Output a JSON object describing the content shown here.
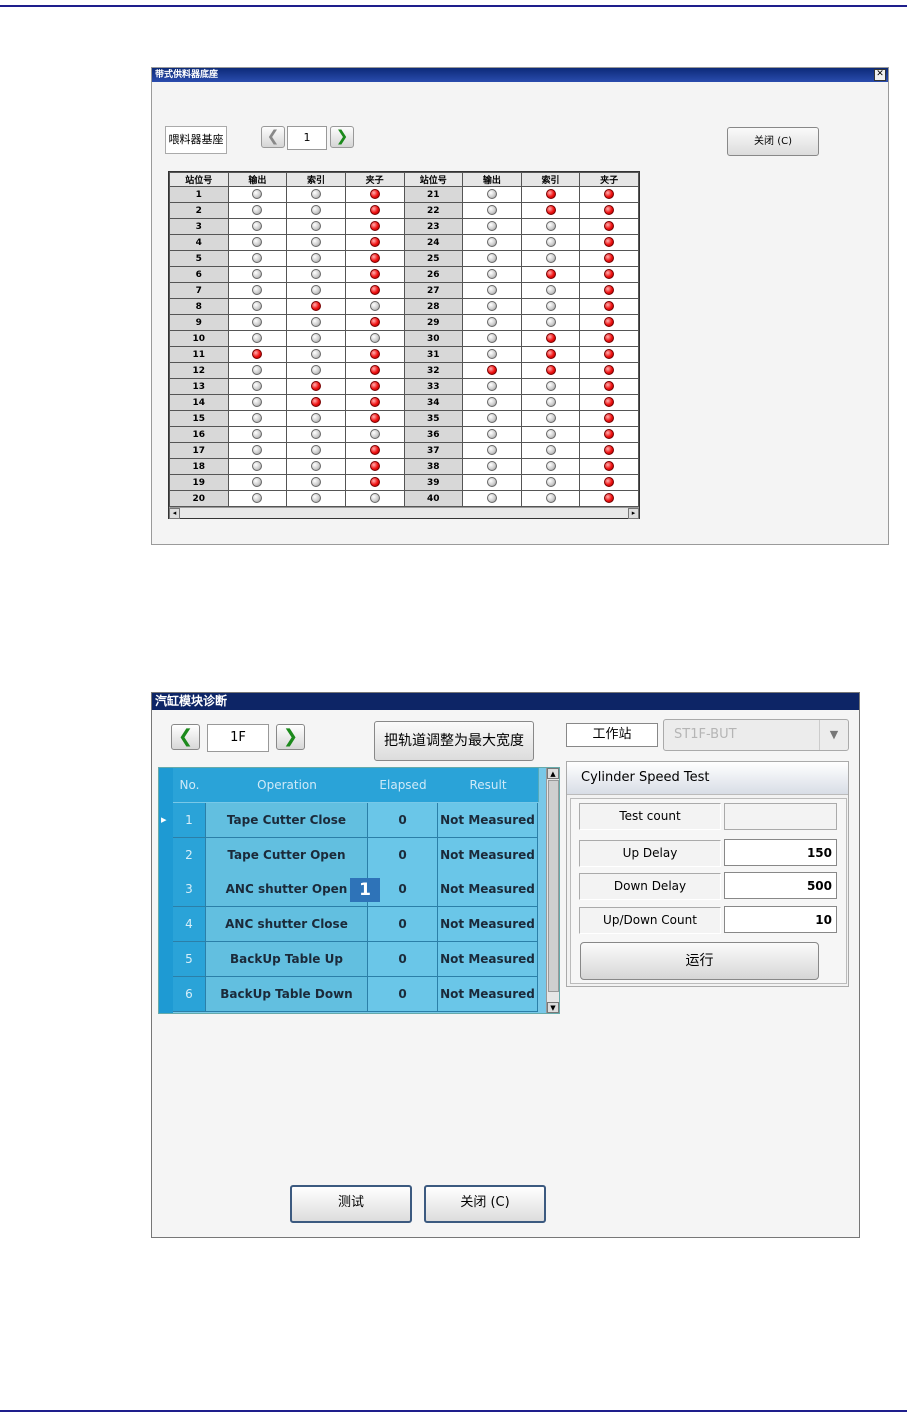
{
  "window1": {
    "title": "带式供料器底座",
    "close_x": "✕",
    "label": "喂料器基座",
    "page": "1",
    "close_button": "关闭 (C)",
    "prev": "❮",
    "next": "❯",
    "headers": [
      "站位号",
      "输出",
      "索引",
      "夹子",
      "站位号",
      "输出",
      "索引",
      "夹子"
    ],
    "rows": [
      {
        "a": "1",
        "a_out": 0,
        "a_idx": 0,
        "a_clamp": 1,
        "b": "21",
        "b_out": 0,
        "b_idx": 1,
        "b_clamp": 1
      },
      {
        "a": "2",
        "a_out": 0,
        "a_idx": 0,
        "a_clamp": 1,
        "b": "22",
        "b_out": 0,
        "b_idx": 1,
        "b_clamp": 1
      },
      {
        "a": "3",
        "a_out": 0,
        "a_idx": 0,
        "a_clamp": 1,
        "b": "23",
        "b_out": 0,
        "b_idx": 0,
        "b_clamp": 1
      },
      {
        "a": "4",
        "a_out": 0,
        "a_idx": 0,
        "a_clamp": 1,
        "b": "24",
        "b_out": 0,
        "b_idx": 0,
        "b_clamp": 1
      },
      {
        "a": "5",
        "a_out": 0,
        "a_idx": 0,
        "a_clamp": 1,
        "b": "25",
        "b_out": 0,
        "b_idx": 0,
        "b_clamp": 1
      },
      {
        "a": "6",
        "a_out": 0,
        "a_idx": 0,
        "a_clamp": 1,
        "b": "26",
        "b_out": 0,
        "b_idx": 1,
        "b_clamp": 1
      },
      {
        "a": "7",
        "a_out": 0,
        "a_idx": 0,
        "a_clamp": 1,
        "b": "27",
        "b_out": 0,
        "b_idx": 0,
        "b_clamp": 1
      },
      {
        "a": "8",
        "a_out": 0,
        "a_idx": 1,
        "a_clamp": 0,
        "b": "28",
        "b_out": 0,
        "b_idx": 0,
        "b_clamp": 1
      },
      {
        "a": "9",
        "a_out": 0,
        "a_idx": 0,
        "a_clamp": 1,
        "b": "29",
        "b_out": 0,
        "b_idx": 0,
        "b_clamp": 1
      },
      {
        "a": "10",
        "a_out": 0,
        "a_idx": 0,
        "a_clamp": 0,
        "b": "30",
        "b_out": 0,
        "b_idx": 1,
        "b_clamp": 1
      },
      {
        "a": "11",
        "a_out": 1,
        "a_idx": 0,
        "a_clamp": 1,
        "b": "31",
        "b_out": 0,
        "b_idx": 1,
        "b_clamp": 1
      },
      {
        "a": "12",
        "a_out": 0,
        "a_idx": 0,
        "a_clamp": 1,
        "b": "32",
        "b_out": 1,
        "b_idx": 1,
        "b_clamp": 1
      },
      {
        "a": "13",
        "a_out": 0,
        "a_idx": 1,
        "a_clamp": 1,
        "b": "33",
        "b_out": 0,
        "b_idx": 0,
        "b_clamp": 1
      },
      {
        "a": "14",
        "a_out": 0,
        "a_idx": 1,
        "a_clamp": 1,
        "b": "34",
        "b_out": 0,
        "b_idx": 0,
        "b_clamp": 1
      },
      {
        "a": "15",
        "a_out": 0,
        "a_idx": 0,
        "a_clamp": 1,
        "b": "35",
        "b_out": 0,
        "b_idx": 0,
        "b_clamp": 1
      },
      {
        "a": "16",
        "a_out": 0,
        "a_idx": 0,
        "a_clamp": 0,
        "b": "36",
        "b_out": 0,
        "b_idx": 0,
        "b_clamp": 1
      },
      {
        "a": "17",
        "a_out": 0,
        "a_idx": 0,
        "a_clamp": 1,
        "b": "37",
        "b_out": 0,
        "b_idx": 0,
        "b_clamp": 1
      },
      {
        "a": "18",
        "a_out": 0,
        "a_idx": 0,
        "a_clamp": 1,
        "b": "38",
        "b_out": 0,
        "b_idx": 0,
        "b_clamp": 1
      },
      {
        "a": "19",
        "a_out": 0,
        "a_idx": 0,
        "a_clamp": 1,
        "b": "39",
        "b_out": 0,
        "b_idx": 0,
        "b_clamp": 1
      },
      {
        "a": "20",
        "a_out": 0,
        "a_idx": 0,
        "a_clamp": 0,
        "b": "40",
        "b_out": 0,
        "b_idx": 0,
        "b_clamp": 1
      }
    ]
  },
  "window2": {
    "title": "汽缸模块诊断",
    "prev": "❮",
    "next": "❯",
    "floor": "1F",
    "max_width_button": "把轨道调整为最大宽度",
    "workstation_label": "工作站",
    "workstation_value": "ST1F-BUT",
    "dropdown_arrow": "▼",
    "columns": [
      "No.",
      "Operation",
      "Elapsed",
      "Result"
    ],
    "rows": [
      {
        "no": "1",
        "op": "Tape Cutter Close",
        "elapsed": "0",
        "result": "Not Measured",
        "current": true
      },
      {
        "no": "2",
        "op": "Tape Cutter Open",
        "elapsed": "0",
        "result": "Not Measured",
        "current": false
      },
      {
        "no": "3",
        "op": "ANC shutter Open",
        "elapsed": "0",
        "result": "Not Measured",
        "current": false
      },
      {
        "no": "4",
        "op": "ANC shutter Close",
        "elapsed": "0",
        "result": "Not Measured",
        "current": false
      },
      {
        "no": "5",
        "op": "BackUp Table Up",
        "elapsed": "0",
        "result": "Not Measured",
        "current": false
      },
      {
        "no": "6",
        "op": "BackUp Table Down",
        "elapsed": "0",
        "result": "Not Measured",
        "current": false
      }
    ],
    "current_row_marker": "▸",
    "callout": "1",
    "scroll_up": "▲",
    "scroll_down": "▼",
    "panel": {
      "header": "Cylinder Speed Test",
      "test_count_label": "Test count",
      "test_count_value": "",
      "up_delay_label": "Up Delay",
      "up_delay_value": "150",
      "down_delay_label": "Down Delay",
      "down_delay_value": "500",
      "updown_count_label": "Up/Down Count",
      "updown_count_value": "10",
      "run_button": "运行"
    },
    "test_button": "测试",
    "close_button": "关闭 (C)"
  }
}
